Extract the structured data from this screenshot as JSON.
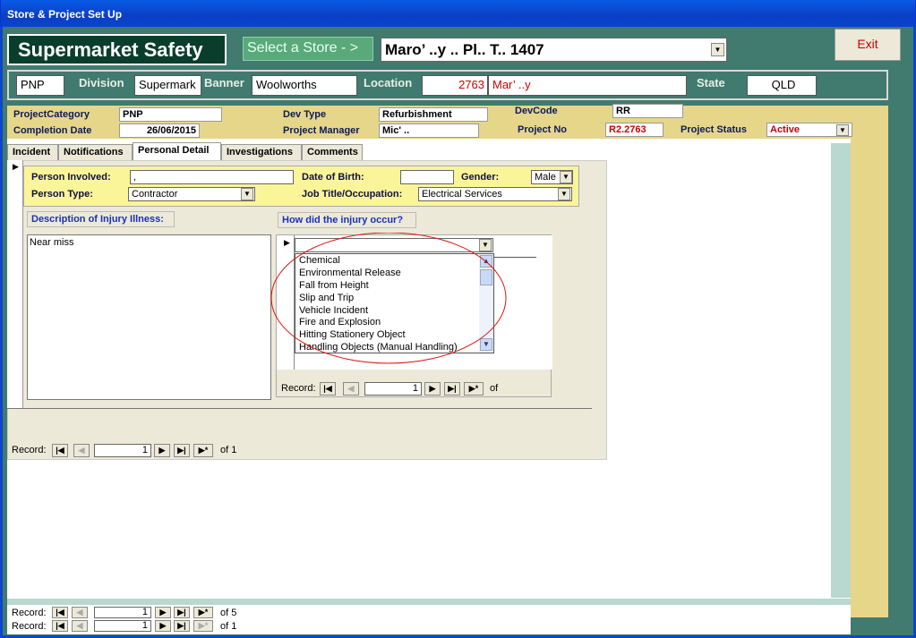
{
  "window": {
    "title": "Store & Project Set Up"
  },
  "header": {
    "app_name": "Supermarket Safety",
    "select_store_label": "Select a Store - >",
    "store_value": "Maro’ ..y  ..   Pl.. T..  1407",
    "exit_label": "Exit"
  },
  "store_bar": {
    "code": "PNP",
    "division_label": "Division",
    "division": "Supermark",
    "banner_label": "Banner",
    "banner": "Woolworths",
    "location_label": "Location",
    "location_num": "2763",
    "location_name": "Mar’ ..y",
    "state_label": "State",
    "state": "QLD"
  },
  "project": {
    "category_label": "ProjectCategory",
    "category": "PNP",
    "completion_label": "Completion Date",
    "completion": "26/06/2015",
    "devtype_label": "Dev Type",
    "devtype": "Refurbishment",
    "pm_label": "Project Manager",
    "pm": "Mic' ..",
    "devcode_label": "DevCode",
    "devcode": "RR",
    "projno_label": "Project No",
    "projno": "R2.2763",
    "status_label": "Project Status",
    "status": "Active"
  },
  "tabs": [
    "Incident",
    "Notifications",
    "Personal Detail",
    "Investigations",
    "Comments"
  ],
  "personal": {
    "person_label": "Person Involved:",
    "person": ",",
    "dob_label": "Date of Birth:",
    "dob": "",
    "gender_label": "Gender:",
    "gender": "Male",
    "type_label": "Person Type:",
    "type": "Contractor",
    "job_label": "Job Title/Occupation:",
    "job": "Electrical Services"
  },
  "injury": {
    "desc_label": "Description of Injury Illness:",
    "desc": "Near miss",
    "how_label": "How did the injury occur?",
    "options": [
      "Chemical",
      "Environmental Release",
      "Fall from Height",
      "Slip and Trip",
      "Vehicle Incident",
      "Fire and Explosion",
      "Hitting Stationery Object",
      "Handling Objects (Manual Handling)"
    ]
  },
  "records": {
    "label": "Record:",
    "sub_rec": "1",
    "sub_of": "of",
    "form_rec": "1",
    "form_of": "of  1",
    "b1_rec": "1",
    "b1_of": "of  5",
    "b2_rec": "1",
    "b2_of": "of  1"
  },
  "colors": {
    "accent_red": "#cc0000",
    "title_blue": "#0a3fc4"
  }
}
